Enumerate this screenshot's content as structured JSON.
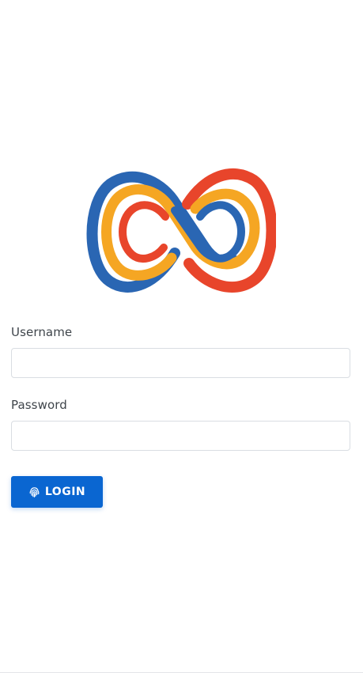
{
  "brand": {
    "logo_icon": "infinity-logo-icon",
    "colors": {
      "blue": "#2a66b3",
      "orange": "#f5a623",
      "red": "#e8452b"
    }
  },
  "form": {
    "username_label": "Username",
    "username_value": "",
    "password_label": "Password",
    "password_value": ""
  },
  "login_button": {
    "label": "LOGIN",
    "icon": "fingerprint-icon",
    "color": "#0a66d1"
  }
}
